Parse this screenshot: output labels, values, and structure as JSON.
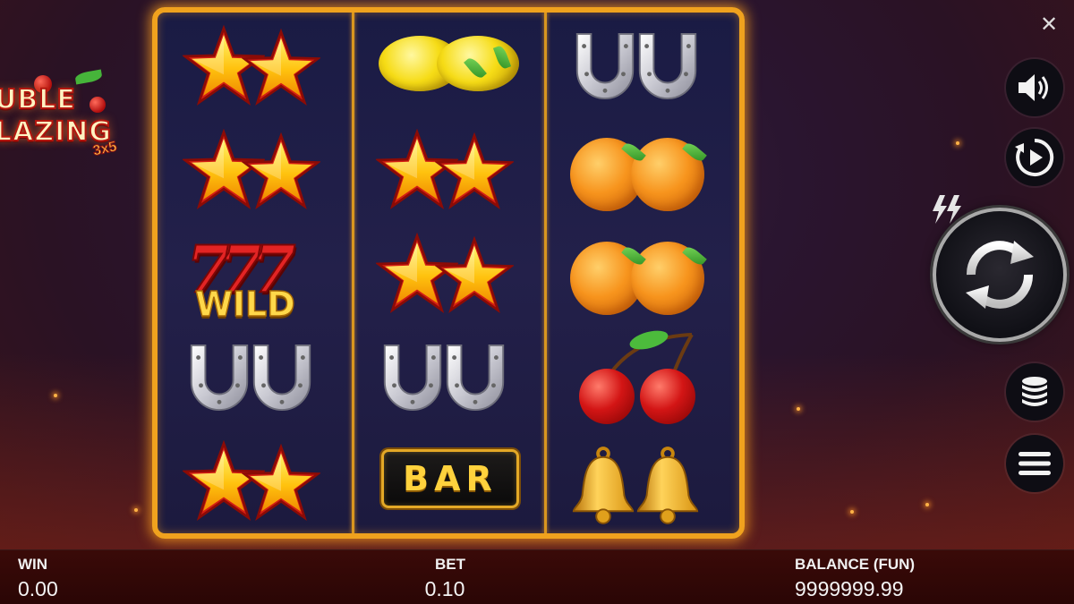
{
  "game": {
    "logo_line1": "UBLE",
    "logo_line2": "LAZING",
    "logo_sub": "3x5"
  },
  "reels": [
    [
      "star",
      "star",
      "wild",
      "horseshoe",
      "star"
    ],
    [
      "lemon",
      "star",
      "star",
      "horseshoe",
      "bar"
    ],
    [
      "horseshoe",
      "orange",
      "orange",
      "cherry",
      "bell"
    ]
  ],
  "symbols": {
    "wild_number": "777",
    "wild_label": "WILD",
    "bar_label": "BAR"
  },
  "controls": {
    "close_glyph": "✕",
    "sound_icon": "speaker-icon",
    "autoplay_icon": "autoplay-icon",
    "turbo_icon": "lightning-icon",
    "spin_icon": "spin-arrows-icon",
    "stake_icon": "coin-stack-icon",
    "menu_icon": "hamburger-icon"
  },
  "footer": {
    "win_label": "WIN",
    "win_value": "0.00",
    "bet_label": "BET",
    "bet_value": "0.10",
    "balance_label": "BALANCE (FUN)",
    "balance_value": "9999999.99"
  },
  "colors": {
    "frame": "#f0a21e",
    "accent_gold": "#ffd84a",
    "footer_bg": "#3a0a08"
  }
}
